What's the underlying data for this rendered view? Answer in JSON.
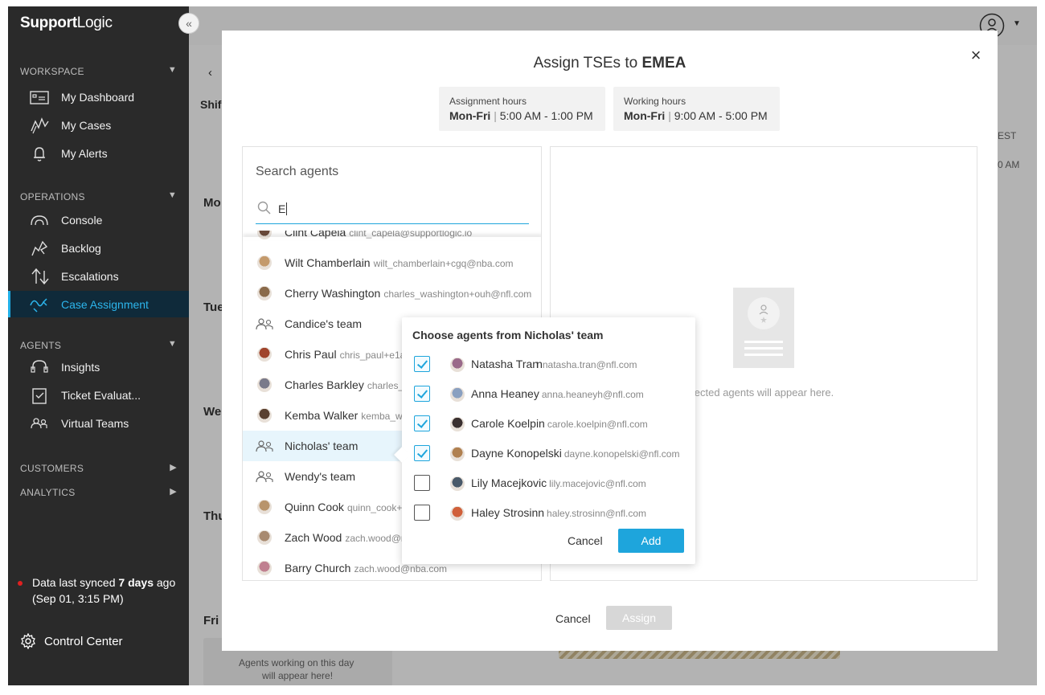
{
  "app": {
    "logo_bold": "Support",
    "logo_light": "Logic",
    "collapse_icon": "double-chevron-left-icon"
  },
  "sidebar": {
    "workspace_label": "WORKSPACE",
    "operations_label": "OPERATIONS",
    "agents_label": "AGENTS",
    "customers_label": "CUSTOMERS",
    "analytics_label": "ANALYTICS",
    "items": {
      "my_dashboard": "My Dashboard",
      "my_cases": "My Cases",
      "my_alerts": "My Alerts",
      "console": "Console",
      "backlog": "Backlog",
      "escalations": "Escalations",
      "case_assignment": "Case Assignment",
      "insights": "Insights",
      "ticket_evaluation": "Ticket Evaluat...",
      "virtual_teams": "Virtual Teams"
    },
    "sync_prefix": "Data last synced ",
    "sync_bold": "7 days",
    "sync_suffix": " ago (Sep 01, 3:15 PM)",
    "control_center": "Control Center",
    "accent_color": "#20b0e8"
  },
  "background": {
    "tab_label": "Shif",
    "timezone": "EST",
    "time_label": "0 AM",
    "days": [
      "Mo",
      "Tue",
      "We",
      "Thu",
      "Fri"
    ],
    "empty_day_text": "Agents working on this day",
    "empty_day_text2": "will appear here!"
  },
  "modal": {
    "title_prefix": "Assign TSEs to ",
    "title_team": "EMEA",
    "assignment_hours_label": "Assignment hours",
    "assignment_hours_days": "Mon-Fri",
    "assignment_hours_time": "5:00 AM - 1:00 PM",
    "working_hours_label": "Working hours",
    "working_hours_days": "Mon-Fri",
    "working_hours_time": "9:00 AM - 5:00 PM",
    "search_label": "Search agents",
    "search_value": "E",
    "empty_selected_text": "Selected agents will appear here.",
    "cancel_label": "Cancel",
    "assign_label": "Assign"
  },
  "agents": [
    {
      "name": "Clint Capela",
      "email": "clint_capela@supportlogic.io",
      "type": "person",
      "color": "#6b4a3a"
    },
    {
      "name": "Wilt Chamberlain",
      "email": "wilt_chamberlain+cgq@nba.com",
      "type": "person",
      "color": "#c49a6c"
    },
    {
      "name": "Cherry Washington",
      "email": "charles_washington+ouh@nfl.com",
      "type": "person",
      "color": "#8a6a4a"
    },
    {
      "name": "Candice's team",
      "email": "",
      "type": "team",
      "color": "#666666"
    },
    {
      "name": "Chris Paul",
      "email": "chris_paul+e1a",
      "type": "person",
      "color": "#a0442c"
    },
    {
      "name": "Charles Barkley",
      "email": "charles_b",
      "type": "person",
      "color": "#7a7a8a"
    },
    {
      "name": "Kemba Walker",
      "email": "kemba_w",
      "type": "person",
      "color": "#5a4030"
    },
    {
      "name": "Nicholas' team",
      "email": "",
      "type": "team",
      "color": "#666666"
    },
    {
      "name": "Wendy's team",
      "email": "",
      "type": "team",
      "color": "#666666"
    },
    {
      "name": "Quinn Cook",
      "email": "quinn_cook+",
      "type": "person",
      "color": "#b8946c"
    },
    {
      "name": "Zach Wood",
      "email": "zach.wood@n",
      "type": "person",
      "color": "#a88a70"
    },
    {
      "name": "Barry Church",
      "email": "zach.wood@nba.com",
      "type": "person",
      "color": "#c08090"
    }
  ],
  "popover": {
    "title": "Choose agents from Nicholas' team",
    "members": [
      {
        "name": "Natasha Tran",
        "email": "natasha.tran@nfl.com",
        "prefix": "n",
        "checked": true,
        "color": "#9a6a8a"
      },
      {
        "name": "Anna Heaney",
        "email": "anna.heaneyh@nfl.com",
        "prefix": "",
        "checked": true,
        "color": "#8aa0c0"
      },
      {
        "name": "Carole Koelpin",
        "email": "carole.koelpin@nfl.com",
        "prefix": "",
        "checked": true,
        "color": "#3a3030"
      },
      {
        "name": "Dayne Konopelski",
        "email": "dayne.konopelski@nfl.com",
        "prefix": "",
        "checked": true,
        "color": "#b08050"
      },
      {
        "name": "Lily Macejkovic",
        "email": "lily.macejovic@nfl.com",
        "prefix": "",
        "checked": false,
        "color": "#4a5a6a"
      },
      {
        "name": "Haley Strosinn",
        "email": "haley.strosinn@nfl.com",
        "prefix": "",
        "checked": false,
        "color": "#d0603a"
      }
    ],
    "cancel_label": "Cancel",
    "add_label": "Add"
  }
}
